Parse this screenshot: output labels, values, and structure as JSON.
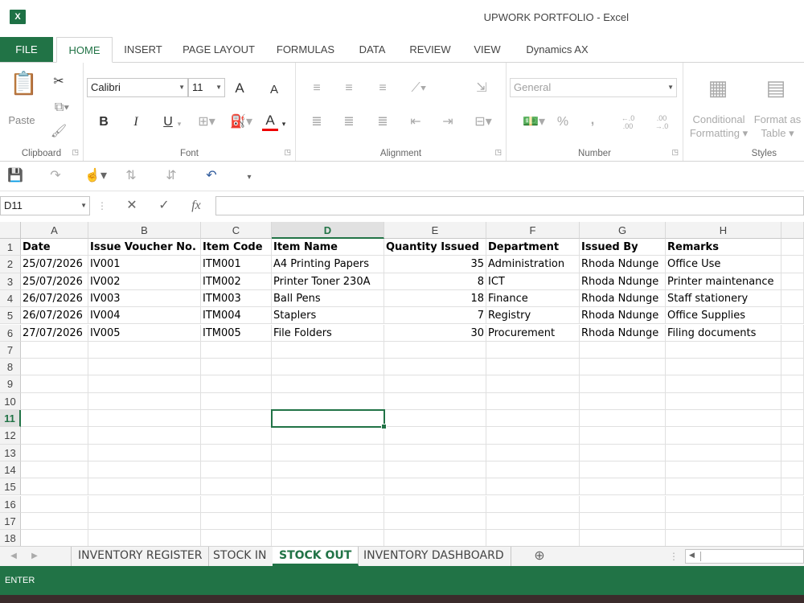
{
  "window": {
    "title": "UPWORK PORTFOLIO - Excel",
    "app_icon": "excel-logo"
  },
  "ribbon_tabs": [
    "FILE",
    "HOME",
    "INSERT",
    "PAGE LAYOUT",
    "FORMULAS",
    "DATA",
    "REVIEW",
    "VIEW",
    "Dynamics AX"
  ],
  "active_tab": "HOME",
  "ribbon": {
    "clipboard": {
      "paste_label": "Paste",
      "group_label": "Clipboard"
    },
    "font": {
      "name": "Calibri",
      "size": "11",
      "bold": "B",
      "italic": "I",
      "underline": "U",
      "font_color": "A",
      "grow": "A",
      "shrink": "A",
      "group_label": "Font"
    },
    "alignment": {
      "group_label": "Alignment"
    },
    "number": {
      "format": "General",
      "percent": "%",
      "comma": ",",
      "inc_decimal": "←.0 .00",
      "dec_decimal": ".00 →.0",
      "group_label": "Number"
    },
    "styles": {
      "conditional_line1": "Conditional",
      "conditional_line2": "Formatting",
      "format_as_table_line1": "Format as",
      "format_as_table_line2": "Table",
      "group_label": "Styles"
    }
  },
  "formula_bar": {
    "name_box": "D11",
    "fx": "fx",
    "value": ""
  },
  "columns": [
    "A",
    "B",
    "C",
    "D",
    "E",
    "F",
    "G",
    "H"
  ],
  "selected_column": "D",
  "selected_row": "11",
  "rows": [
    "1",
    "2",
    "3",
    "4",
    "5",
    "6",
    "7",
    "8",
    "9",
    "10",
    "11",
    "12",
    "13",
    "14",
    "15",
    "16",
    "17",
    "18"
  ],
  "table": {
    "headers": [
      "Date",
      "Issue Voucher No.",
      "Item Code",
      "Item Name",
      "Quantity Issued",
      "Department",
      "Issued By",
      "Remarks"
    ],
    "records": [
      [
        "25/07/2026",
        "IV001",
        "ITM001",
        "A4 Printing Papers",
        "35",
        "Administration",
        "Rhoda Ndunge",
        "Office Use"
      ],
      [
        "25/07/2026",
        "IV002",
        "ITM002",
        "Printer Toner 230A",
        "8",
        "ICT",
        "Rhoda Ndunge",
        "Printer maintenance"
      ],
      [
        "26/07/2026",
        "IV003",
        "ITM003",
        "Ball Pens",
        "18",
        "Finance",
        "Rhoda Ndunge",
        "Staff stationery"
      ],
      [
        "26/07/2026",
        "IV004",
        "ITM004",
        "Staplers",
        "7",
        "Registry",
        "Rhoda Ndunge",
        "Office Supplies"
      ],
      [
        "27/07/2026",
        "IV005",
        "ITM005",
        "File Folders",
        "30",
        "Procurement",
        "Rhoda Ndunge",
        "Filing documents"
      ]
    ]
  },
  "sheets": [
    "INVENTORY REGISTER",
    "STOCK IN",
    "STOCK OUT",
    "INVENTORY DASHBOARD"
  ],
  "active_sheet": "STOCK OUT",
  "status": {
    "mode": "ENTER"
  },
  "colors": {
    "accent": "#217346"
  }
}
